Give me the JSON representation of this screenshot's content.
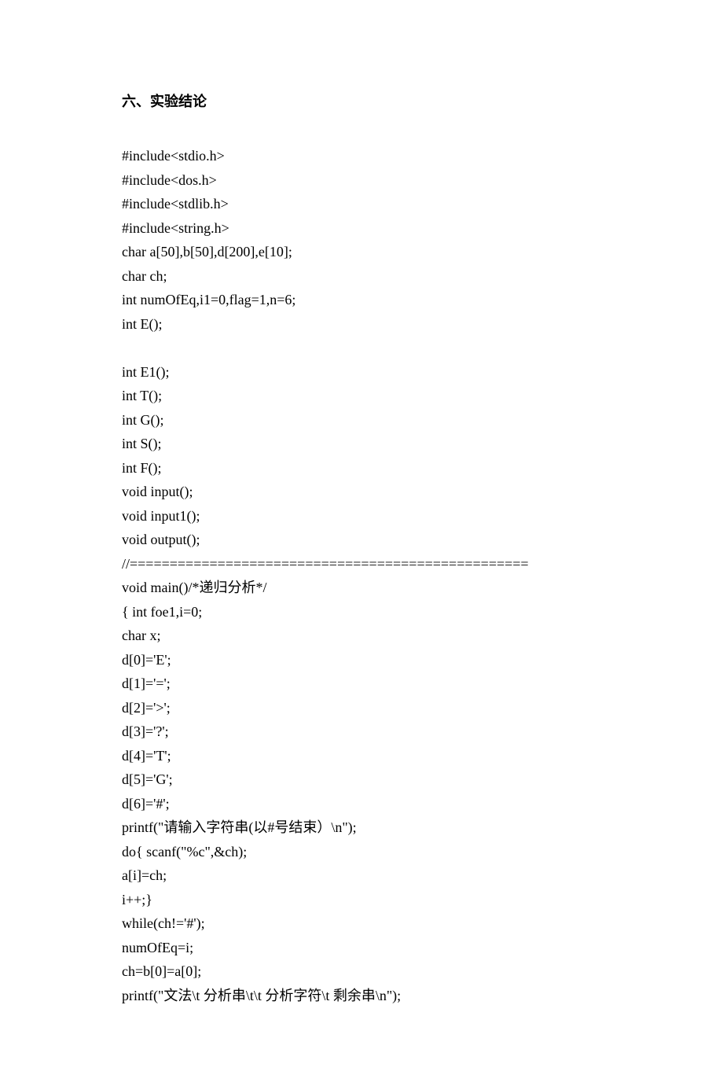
{
  "heading": "六、实验结论",
  "code_lines": [
    "#include<stdio.h>",
    "#include<dos.h>",
    "#include<stdlib.h>",
    "#include<string.h>",
    "char a[50],b[50],d[200],e[10];",
    "char ch;",
    "int numOfEq,i1=0,flag=1,n=6;",
    "int E();",
    "",
    "int E1();",
    "int T();",
    "int G();",
    "int S();",
    "int F();",
    "void input();",
    "void input1();",
    "void output();",
    "//==================================================",
    "void main()/*递归分析*/",
    "{ int foe1,i=0;",
    "char x;",
    "d[0]='E';",
    "d[1]='=';",
    "d[2]='>';",
    "d[3]='?';",
    "d[4]='T';",
    "d[5]='G';",
    "d[6]='#';",
    "printf(\"请输入字符串(以#号结束）\\n\");",
    "do{ scanf(\"%c\",&ch);",
    "a[i]=ch;",
    "i++;}",
    "while(ch!='#');",
    "numOfEq=i;",
    "ch=b[0]=a[0];",
    "printf(\"文法\\t 分析串\\t\\t 分析字符\\t 剩余串\\n\");"
  ]
}
